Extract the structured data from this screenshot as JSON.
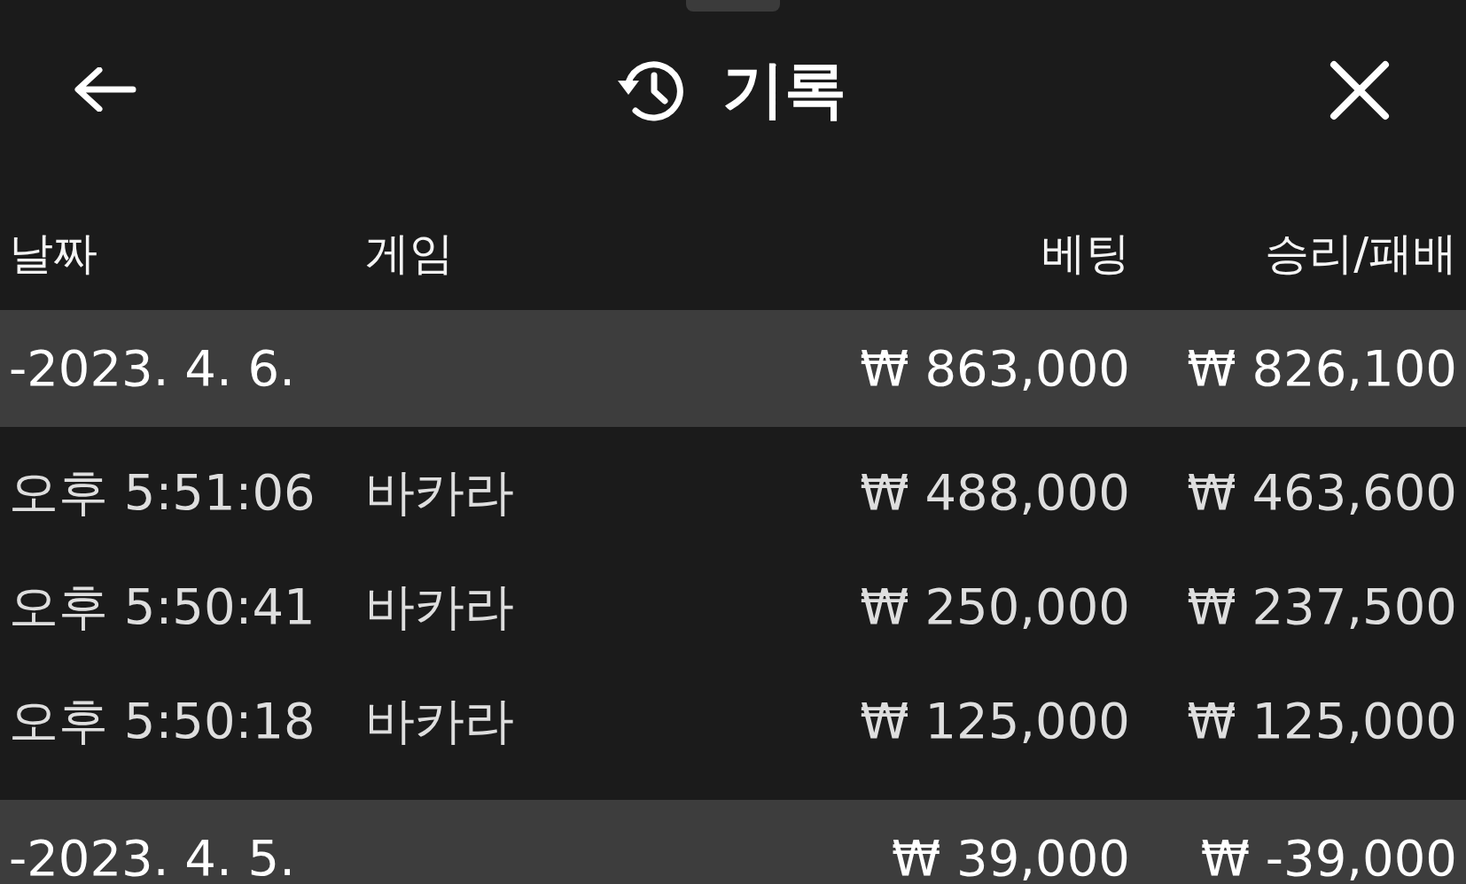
{
  "header": {
    "title": "기록"
  },
  "table": {
    "columns": [
      "날짜",
      "게임",
      "베팅",
      "승리/패배"
    ],
    "groups": [
      {
        "date": "-2023. 4. 6.",
        "bet": "₩ 863,000",
        "result": "₩ 826,100",
        "rows": [
          {
            "time": "오후 5:51:06",
            "game": "바카라",
            "bet": "₩ 488,000",
            "result": "₩ 463,600"
          },
          {
            "time": "오후 5:50:41",
            "game": "바카라",
            "bet": "₩ 250,000",
            "result": "₩ 237,500"
          },
          {
            "time": "오후 5:50:18",
            "game": "바카라",
            "bet": "₩ 125,000",
            "result": "₩ 125,000"
          }
        ]
      },
      {
        "date": "-2023. 4. 5.",
        "bet": "₩ 39,000",
        "result": "₩ -39,000"
      }
    ]
  }
}
